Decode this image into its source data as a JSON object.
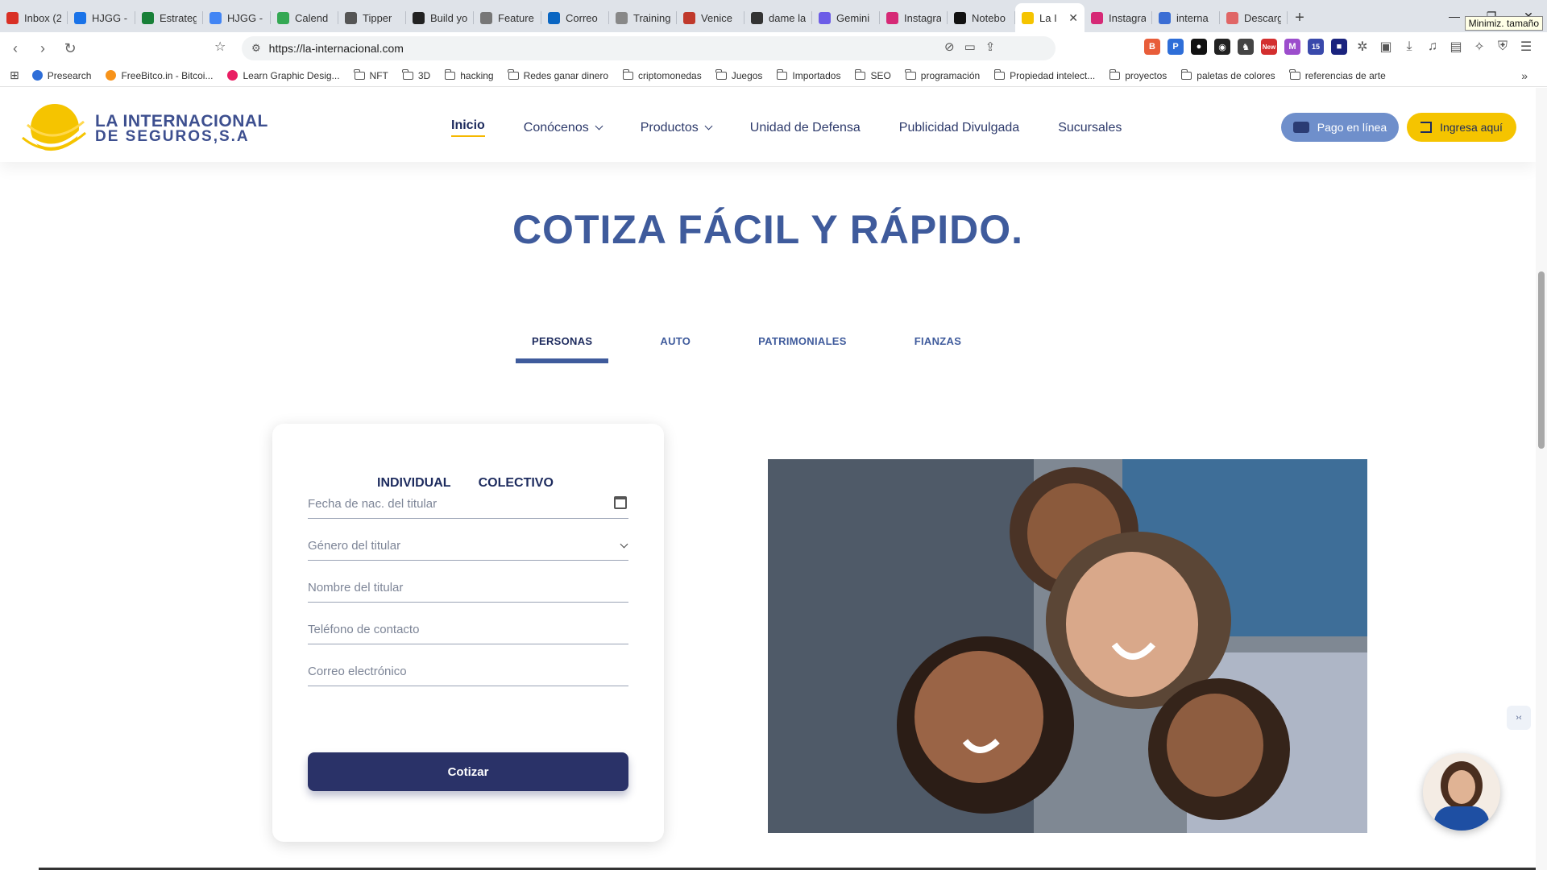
{
  "browser": {
    "tabs": [
      {
        "title": "Inbox (2",
        "color": "#d93025"
      },
      {
        "title": "HJGG -",
        "color": "#1a73e8"
      },
      {
        "title": "Estrateg",
        "color": "#188038"
      },
      {
        "title": "HJGG -",
        "color": "#4285f4"
      },
      {
        "title": "Calend",
        "color": "#34a853"
      },
      {
        "title": "Tipper",
        "color": "#555555"
      },
      {
        "title": "Build yo",
        "color": "#222222"
      },
      {
        "title": "Feature",
        "color": "#777777"
      },
      {
        "title": "Correo",
        "color": "#0a66c2"
      },
      {
        "title": "Training",
        "color": "#888888"
      },
      {
        "title": "Venice",
        "color": "#c0392b"
      },
      {
        "title": "dame la",
        "color": "#333333"
      },
      {
        "title": "Gemini",
        "color": "#6c5ce7"
      },
      {
        "title": "Instagra",
        "color": "#d62976"
      },
      {
        "title": "Notebo",
        "color": "#111111"
      },
      {
        "title": "La I",
        "color": "#f5c400",
        "active": true
      },
      {
        "title": "Instagra",
        "color": "#d62976"
      },
      {
        "title": "interna",
        "color": "#3b6ed4"
      },
      {
        "title": "Descarg",
        "color": "#e06666"
      }
    ],
    "tooltip": "Minimiz. tamaño",
    "url": "https://la-internacional.com",
    "bookmarks": [
      {
        "label": "Presearch",
        "type": "site",
        "color": "#2e6ed8"
      },
      {
        "label": "FreeBitco.in - Bitcoi...",
        "type": "site",
        "color": "#f7931a"
      },
      {
        "label": "Learn Graphic Desig...",
        "type": "site",
        "color": "#e91e63"
      },
      {
        "label": "NFT",
        "type": "folder"
      },
      {
        "label": "3D",
        "type": "folder"
      },
      {
        "label": "hacking",
        "type": "folder"
      },
      {
        "label": "Redes ganar dinero",
        "type": "folder"
      },
      {
        "label": "criptomonedas",
        "type": "folder"
      },
      {
        "label": "Juegos",
        "type": "folder"
      },
      {
        "label": "Importados",
        "type": "folder"
      },
      {
        "label": "SEO",
        "type": "folder"
      },
      {
        "label": "programación",
        "type": "folder"
      },
      {
        "label": "Propiedad intelect...",
        "type": "folder"
      },
      {
        "label": "proyectos",
        "type": "folder"
      },
      {
        "label": "paletas de colores",
        "type": "folder"
      },
      {
        "label": "referencias de arte",
        "type": "folder"
      }
    ],
    "extension_badge": "New",
    "extension_count": "15"
  },
  "site": {
    "logo": {
      "line1": "LA INTERNACIONAL",
      "line2": "DE SEGUROS,S.A"
    },
    "nav": [
      {
        "label": "Inicio",
        "active": true,
        "dropdown": false
      },
      {
        "label": "Conócenos",
        "active": false,
        "dropdown": true
      },
      {
        "label": "Productos",
        "active": false,
        "dropdown": true
      },
      {
        "label": "Unidad de Defensa",
        "active": false,
        "dropdown": false
      },
      {
        "label": "Publicidad Divulgada",
        "active": false,
        "dropdown": false
      },
      {
        "label": "Sucursales",
        "active": false,
        "dropdown": false
      }
    ],
    "pay_button": "Pago en línea",
    "login_button": "Ingresa aquí",
    "hero_title": "COTIZA FÁCIL Y RÁPIDO.",
    "category_tabs": [
      "PERSONAS",
      "AUTO",
      "PATRIMONIALES",
      "FIANZAS"
    ],
    "active_category": "PERSONAS",
    "quote_form": {
      "type_tabs": [
        "INDIVIDUAL",
        "COLECTIVO"
      ],
      "fields": [
        {
          "placeholder": "Fecha de nac. del titular",
          "icon": "calendar-icon"
        },
        {
          "placeholder": "Género del titular",
          "icon": "chevron-down-icon"
        },
        {
          "placeholder": "Nombre del titular",
          "icon": ""
        },
        {
          "placeholder": "Teléfono de contacto",
          "icon": ""
        },
        {
          "placeholder": "Correo electrónico",
          "icon": ""
        }
      ],
      "submit": "Cotizar"
    },
    "colors": {
      "brand_blue": "#3f5b9c",
      "dark_navy": "#2a3268",
      "accent_yellow": "#f5c400",
      "pay_blue": "#6f8fcb"
    }
  }
}
